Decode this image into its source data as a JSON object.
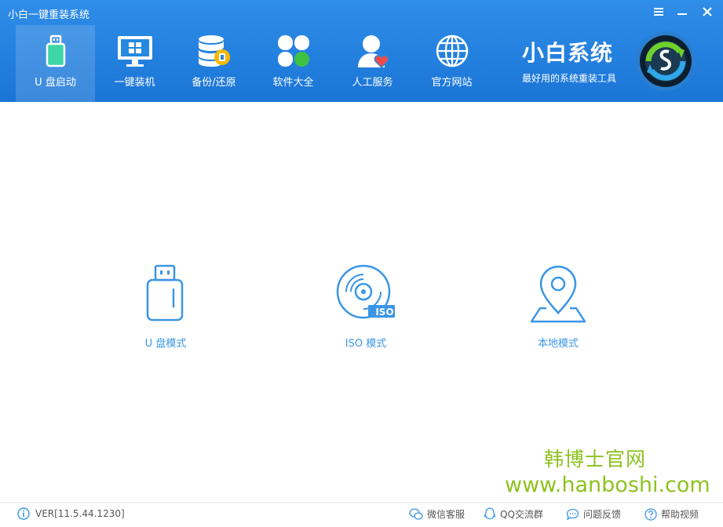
{
  "window": {
    "title": "小白一键重装系统"
  },
  "nav": [
    {
      "label": "U 盘启动",
      "icon": "usb-drive-icon",
      "active": true
    },
    {
      "label": "一键装机",
      "icon": "monitor-icon"
    },
    {
      "label": "备份/还原",
      "icon": "database-icon"
    },
    {
      "label": "软件大全",
      "icon": "apps-icon"
    },
    {
      "label": "人工服务",
      "icon": "user-heart-icon"
    },
    {
      "label": "官方网站",
      "icon": "globe-icon"
    }
  ],
  "brand": {
    "title": "小白系统",
    "subtitle": "最好用的系统重装工具"
  },
  "modes": [
    {
      "label": "U 盘模式",
      "icon": "usb-drive-icon"
    },
    {
      "label": "ISO 模式",
      "icon": "disc-iso-icon",
      "badge": "ISO"
    },
    {
      "label": "本地模式",
      "icon": "location-pin-icon"
    }
  ],
  "watermark": {
    "line1": "韩博士官网",
    "line2": "www.hanboshi.com"
  },
  "footer": {
    "version": "VER[11.5.44.1230]",
    "links": [
      {
        "label": "微信客服",
        "icon": "wechat-icon"
      },
      {
        "label": "QQ交流群",
        "icon": "qq-icon"
      },
      {
        "label": "问题反馈",
        "icon": "chat-bubble-icon"
      },
      {
        "label": "帮助视频",
        "icon": "help-icon"
      }
    ]
  },
  "colors": {
    "header": "#1b75d6",
    "accent": "#3a96e6",
    "watermark": "#8dc21f"
  }
}
